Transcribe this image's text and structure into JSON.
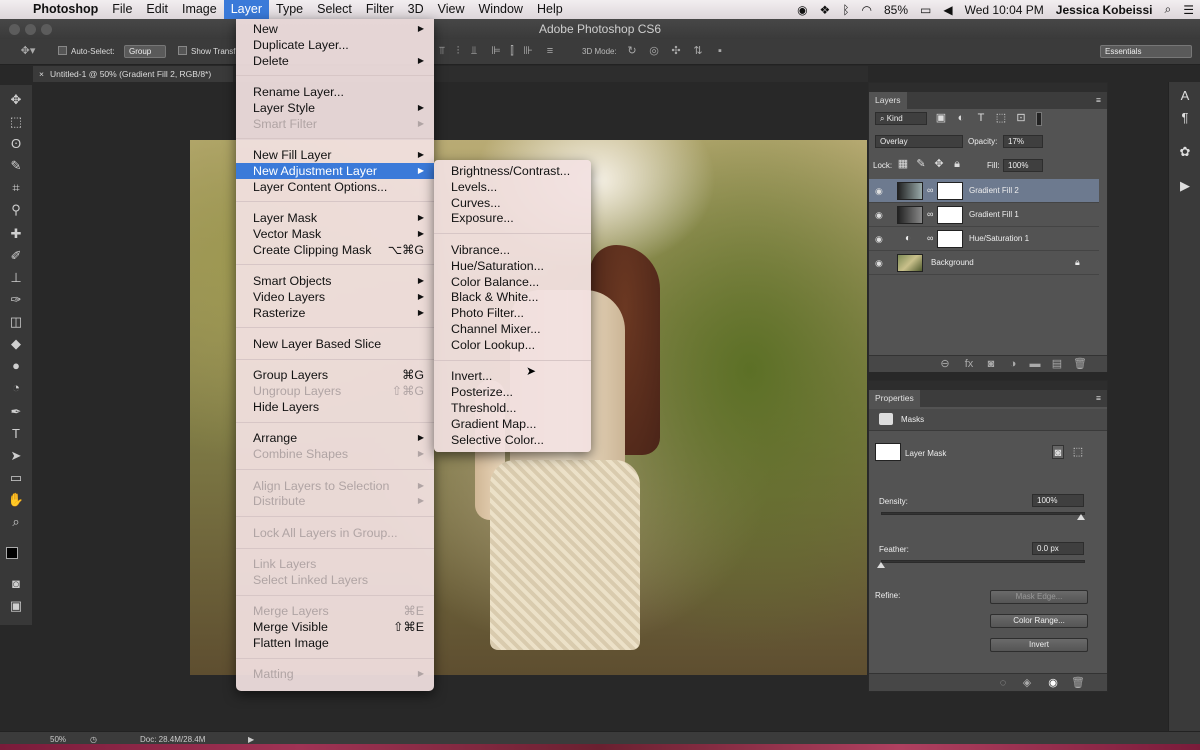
{
  "menubar": {
    "apple": "",
    "app": "Photoshop",
    "items": [
      "File",
      "Edit",
      "Image",
      "Layer",
      "Type",
      "Select",
      "Filter",
      "3D",
      "View",
      "Window",
      "Help"
    ],
    "active": "Layer",
    "battery": "85%",
    "clock": "Wed 10:04 PM",
    "user": "Jessica Kobeissi"
  },
  "titlebar": {
    "title": "Adobe Photoshop CS6"
  },
  "optionsbar": {
    "auto_select": "Auto-Select:",
    "auto_select_value": "Group",
    "show_transform": "Show Transf",
    "mode_3d": "3D Mode:",
    "workspace": "Essentials"
  },
  "document": {
    "tab": "Untitled-1 @ 50% (Gradient Fill 2, RGB/8*)"
  },
  "layer_menu": [
    {
      "label": "New",
      "submenu": true
    },
    {
      "label": "Duplicate Layer..."
    },
    {
      "label": "Delete",
      "submenu": true
    },
    {
      "sep": true
    },
    {
      "label": "Rename Layer..."
    },
    {
      "label": "Layer Style",
      "submenu": true
    },
    {
      "label": "Smart Filter",
      "submenu": true,
      "disabled": true
    },
    {
      "sep": true
    },
    {
      "label": "New Fill Layer",
      "submenu": true
    },
    {
      "label": "New Adjustment Layer",
      "submenu": true,
      "highlighted": true
    },
    {
      "label": "Layer Content Options..."
    },
    {
      "sep": true
    },
    {
      "label": "Layer Mask",
      "submenu": true
    },
    {
      "label": "Vector Mask",
      "submenu": true
    },
    {
      "label": "Create Clipping Mask",
      "shortcut": "⌥⌘G"
    },
    {
      "sep": true
    },
    {
      "label": "Smart Objects",
      "submenu": true
    },
    {
      "label": "Video Layers",
      "submenu": true
    },
    {
      "label": "Rasterize",
      "submenu": true
    },
    {
      "sep": true
    },
    {
      "label": "New Layer Based Slice"
    },
    {
      "sep": true
    },
    {
      "label": "Group Layers",
      "shortcut": "⌘G"
    },
    {
      "label": "Ungroup Layers",
      "shortcut": "⇧⌘G",
      "disabled": true
    },
    {
      "label": "Hide Layers"
    },
    {
      "sep": true
    },
    {
      "label": "Arrange",
      "submenu": true
    },
    {
      "label": "Combine Shapes",
      "submenu": true,
      "disabled": true
    },
    {
      "sep": true
    },
    {
      "label": "Align Layers to Selection",
      "submenu": true,
      "disabled": true
    },
    {
      "label": "Distribute",
      "submenu": true,
      "disabled": true
    },
    {
      "sep": true
    },
    {
      "label": "Lock All Layers in Group...",
      "disabled": true
    },
    {
      "sep": true
    },
    {
      "label": "Link Layers",
      "disabled": true
    },
    {
      "label": "Select Linked Layers",
      "disabled": true
    },
    {
      "sep": true
    },
    {
      "label": "Merge Layers",
      "shortcut": "⌘E",
      "disabled": true
    },
    {
      "label": "Merge Visible",
      "shortcut": "⇧⌘E"
    },
    {
      "label": "Flatten Image"
    },
    {
      "sep": true
    },
    {
      "label": "Matting",
      "submenu": true,
      "disabled": true
    }
  ],
  "adjustment_menu": [
    {
      "label": "Brightness/Contrast..."
    },
    {
      "label": "Levels..."
    },
    {
      "label": "Curves..."
    },
    {
      "label": "Exposure..."
    },
    {
      "sep": true
    },
    {
      "label": "Vibrance..."
    },
    {
      "label": "Hue/Saturation..."
    },
    {
      "label": "Color Balance..."
    },
    {
      "label": "Black & White..."
    },
    {
      "label": "Photo Filter..."
    },
    {
      "label": "Channel Mixer..."
    },
    {
      "label": "Color Lookup..."
    },
    {
      "sep": true
    },
    {
      "label": "Invert..."
    },
    {
      "label": "Posterize..."
    },
    {
      "label": "Threshold..."
    },
    {
      "label": "Gradient Map..."
    },
    {
      "label": "Selective Color..."
    }
  ],
  "layers_panel": {
    "tab": "Layers",
    "kind": "Kind",
    "blend_mode": "Overlay",
    "opacity_label": "Opacity:",
    "opacity": "17%",
    "lock_label": "Lock:",
    "fill_label": "Fill:",
    "fill": "100%",
    "layers": [
      {
        "name": "Gradient Fill 2",
        "selected": true
      },
      {
        "name": "Gradient Fill 1"
      },
      {
        "name": "Hue/Saturation 1"
      },
      {
        "name": "Background"
      }
    ]
  },
  "properties_panel": {
    "tab": "Properties",
    "masks": "Masks",
    "layer_mask": "Layer Mask",
    "density_label": "Density:",
    "density": "100%",
    "density_level": 1.0,
    "feather_label": "Feather:",
    "feather": "0.0 px",
    "feather_level": 0.0,
    "refine_label": "Refine:",
    "mask_edge": "Mask Edge...",
    "color_range": "Color Range...",
    "invert": "Invert"
  },
  "statusbar": {
    "zoom": "50%",
    "doc": "Doc: 28.4M/28.4M"
  }
}
